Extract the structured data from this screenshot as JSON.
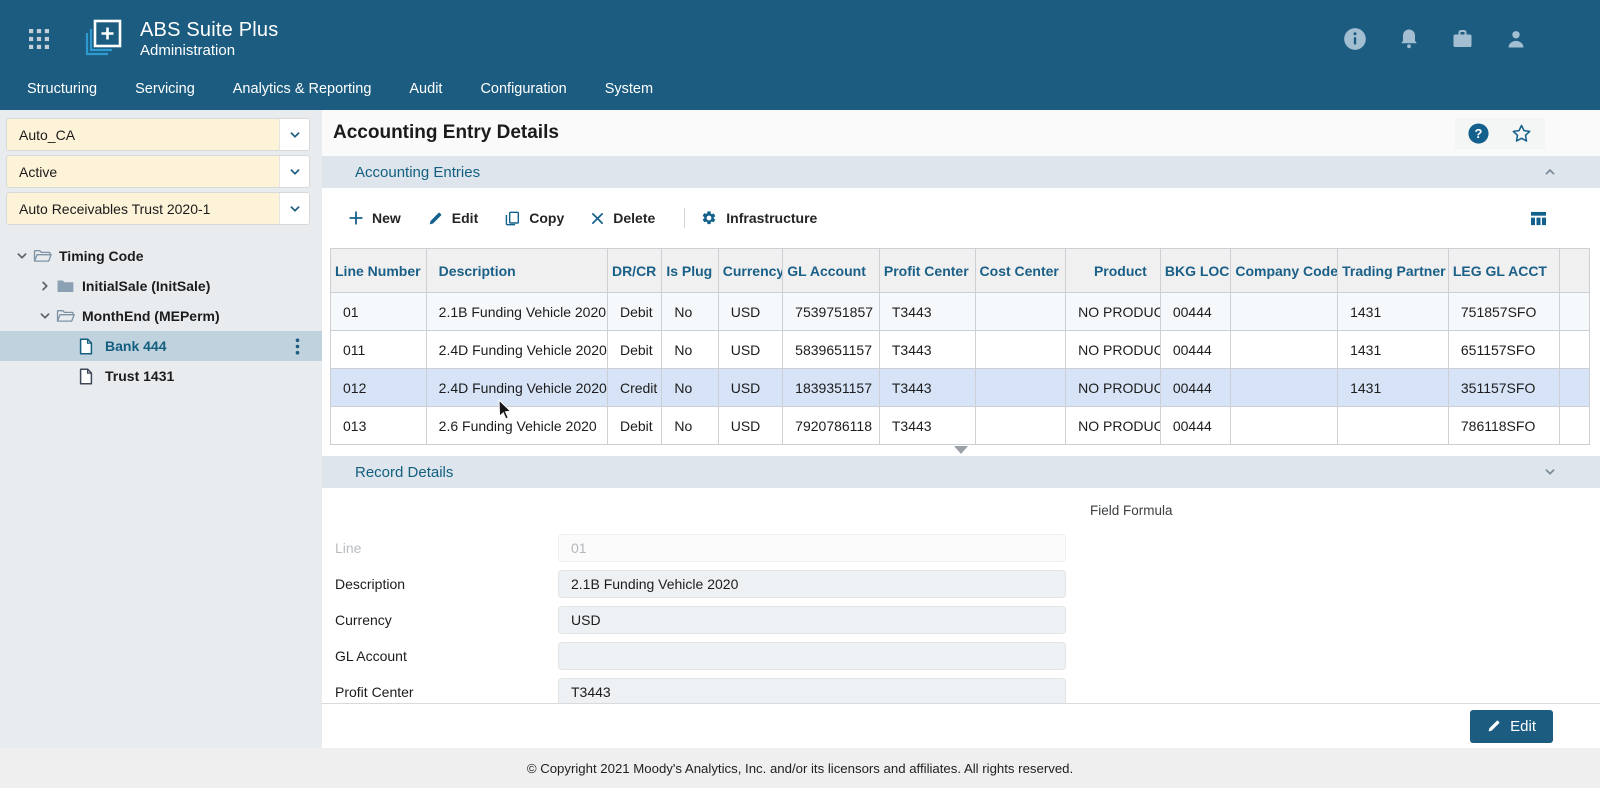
{
  "colors": {
    "header_bg": "#1b5c80",
    "accent": "#14608c",
    "section_bg": "#dee5ec",
    "selection_row": "#d7e3f6",
    "selection_tree": "#bfd2de",
    "dropdown_bg": "#fdf3d8",
    "sidebar_bg": "#e9ecef"
  },
  "header": {
    "app_title": "ABS Suite Plus",
    "app_subtitle": "Administration",
    "nav_items": [
      "Structuring",
      "Servicing",
      "Analytics & Reporting",
      "Audit",
      "Configuration",
      "System"
    ],
    "icons": [
      "apps-grid-icon",
      "info-icon",
      "notifications-icon",
      "briefcase-icon",
      "profile-icon"
    ]
  },
  "sidebar": {
    "dropdowns": [
      {
        "value": "Auto_CA"
      },
      {
        "value": "Active"
      },
      {
        "value": "Auto Receivables Trust 2020-1"
      }
    ],
    "tree": [
      {
        "label": "Timing Code",
        "type": "folder-open",
        "level": 0,
        "expanded": true,
        "selected": false
      },
      {
        "label": "InitialSale (InitSale)",
        "type": "folder-closed",
        "level": 1,
        "expanded": false,
        "selected": false
      },
      {
        "label": "MonthEnd (MEPerm)",
        "type": "folder-open",
        "level": 1,
        "expanded": true,
        "selected": false
      },
      {
        "label": "Bank 444",
        "type": "file",
        "level": 2,
        "selected": true,
        "has_menu": true
      },
      {
        "label": "Trust 1431",
        "type": "file",
        "level": 2,
        "selected": false
      }
    ]
  },
  "main": {
    "page_title": "Accounting Entry Details",
    "section_entries": {
      "title": "Accounting Entries"
    },
    "toolbar": {
      "new_label": "New",
      "edit_label": "Edit",
      "copy_label": "Copy",
      "delete_label": "Delete",
      "infrastructure_label": "Infrastructure"
    },
    "table": {
      "columns": [
        "Line Number",
        "Description",
        "DR/CR",
        "Is Plug",
        "Currency",
        "GL Account",
        "Profit Center",
        "Cost Center",
        "Product",
        "BKG LOC",
        "Company Code",
        "Trading Partner",
        "LEG GL ACCT"
      ],
      "rows": [
        {
          "cells": [
            "01",
            "2.1B Funding Vehicle 2020",
            "Debit",
            "No",
            "USD",
            "7539751857",
            "T3443",
            "",
            "NO PRODUCT",
            "00444",
            "",
            "1431",
            "751857SFO"
          ],
          "selected": false
        },
        {
          "cells": [
            "011",
            "2.4D Funding Vehicle 2020",
            "Debit",
            "No",
            "USD",
            "5839651157",
            "T3443",
            "",
            "NO PRODUCT",
            "00444",
            "",
            "1431",
            "651157SFO"
          ],
          "selected": false
        },
        {
          "cells": [
            "012",
            "2.4D Funding Vehicle 2020",
            "Credit",
            "No",
            "USD",
            "1839351157",
            "T3443",
            "",
            "NO PRODUCT",
            "00444",
            "",
            "1431",
            "351157SFO"
          ],
          "selected": true
        },
        {
          "cells": [
            "013",
            "2.6 Funding Vehicle 2020",
            "Debit",
            "No",
            "USD",
            "7920786118",
            "T3443",
            "",
            "NO PRODUCT",
            "00444",
            "",
            "",
            "786118SFO"
          ],
          "selected": false
        }
      ]
    },
    "section_record": {
      "title": "Record Details",
      "formula_label": "Field Formula"
    },
    "form": {
      "fields": [
        {
          "label": "Line",
          "value": "01",
          "disabled": true
        },
        {
          "label": "Description",
          "value": "2.1B Funding Vehicle 2020",
          "disabled": false
        },
        {
          "label": "Currency",
          "value": "USD",
          "disabled": false
        },
        {
          "label": "GL Account",
          "value": "",
          "disabled": false
        },
        {
          "label": "Profit Center",
          "value": "T3443",
          "disabled": false
        }
      ]
    },
    "action_bar": {
      "edit_label": "Edit"
    }
  },
  "footer": {
    "copyright": "© Copyright 2021 Moody's Analytics, Inc. and/or its licensors and affiliates. All rights reserved."
  }
}
